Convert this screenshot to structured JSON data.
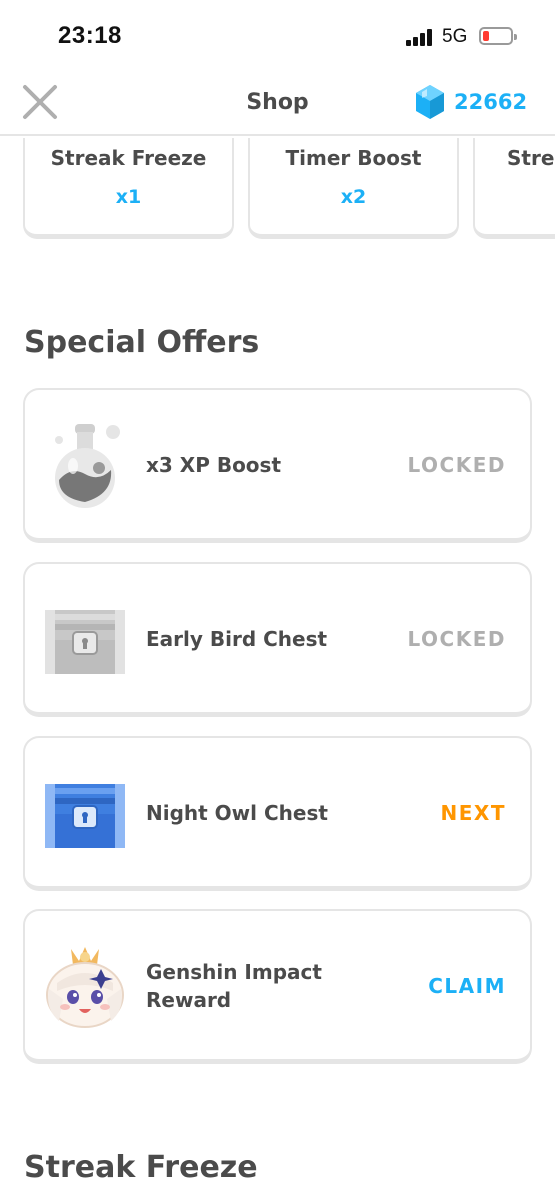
{
  "status_bar": {
    "time": "23:18",
    "network": "5G"
  },
  "header": {
    "title": "Shop",
    "gem_count": "22662",
    "close_icon": "close-icon",
    "gem_icon": "gem-icon"
  },
  "top_items": [
    {
      "name": "Streak Freeze",
      "quantity": "x1"
    },
    {
      "name": "Timer Boost",
      "quantity": "x2"
    },
    {
      "name": "Strea",
      "quantity": ""
    }
  ],
  "special_offers": {
    "title": "Special Offers",
    "items": [
      {
        "name": "x3 XP Boost",
        "status": "LOCKED",
        "icon": "potion-icon",
        "status_color": "#afafaf"
      },
      {
        "name": "Early Bird Chest",
        "status": "LOCKED",
        "icon": "gray-chest-icon",
        "status_color": "#afafaf"
      },
      {
        "name": "Night Owl Chest",
        "status": "NEXT",
        "icon": "blue-chest-icon",
        "status_color": "#ff9600"
      },
      {
        "name": "Genshin Impact Reward",
        "status": "CLAIM",
        "icon": "paimon-avatar-icon",
        "status_color": "#1cb0f6"
      }
    ]
  },
  "streak_freeze_section": {
    "title": "Streak Freeze"
  },
  "colors": {
    "accent_blue": "#1cb0f6",
    "next_orange": "#ff9600",
    "locked_gray": "#afafaf",
    "text": "#4b4b4b",
    "border": "#e5e5e5"
  }
}
